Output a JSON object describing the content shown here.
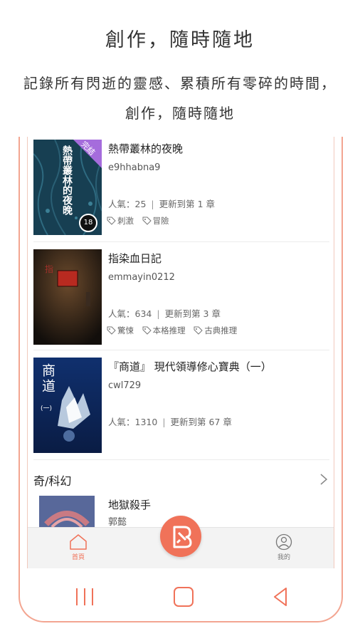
{
  "headline": "創作，隨時隨地",
  "subline": "記錄所有閃逝的靈感、累積所有零碎的時間，創作，隨時隨地",
  "books": [
    {
      "title": "熱帶叢林的夜晚",
      "author": "e9hhabna9",
      "popularity": "人氣：25",
      "update": "更新到第 1 章",
      "tags": [
        "刺激",
        "冒險"
      ],
      "cover_text": "熱帶叢林的夜晚",
      "badge": "完結",
      "rating_badge": "18"
    },
    {
      "title": "指染血日記",
      "author": "emmayin0212",
      "popularity": "人氣：634",
      "update": "更新到第 3 章",
      "tags": [
        "驚悚",
        "本格推理",
        "古典推理"
      ]
    },
    {
      "title": "『商道』 現代領導修心寶典（一）",
      "author": "cwl729",
      "popularity": "人氣：1310",
      "update": "更新到第 67 章",
      "tags": [],
      "cover_text": "商道",
      "cover_sub": "(一)"
    }
  ],
  "section": {
    "title": "奇/科幻",
    "next_book_title": "地獄殺手",
    "next_book_author": "郭懿"
  },
  "tabs": {
    "home": "首頁",
    "profile": "我的"
  },
  "colors": {
    "accent": "#f07259",
    "phone_frame": "#f3a591"
  }
}
